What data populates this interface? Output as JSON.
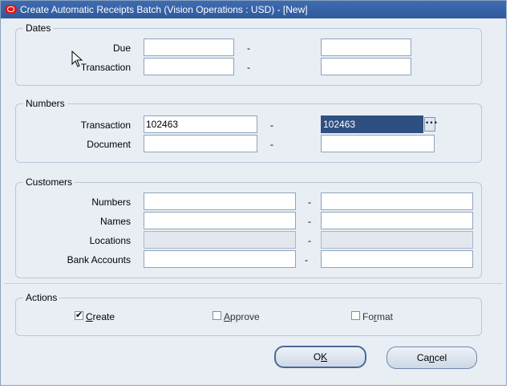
{
  "window": {
    "title": "Create Automatic Receipts Batch (Vision Operations : USD) - [New]"
  },
  "dates": {
    "group_label": "Dates",
    "due_label": "Due",
    "transaction_label": "Transaction",
    "due_from": "",
    "due_to": "",
    "transaction_from": "",
    "transaction_to": ""
  },
  "numbers": {
    "group_label": "Numbers",
    "transaction_label": "Transaction",
    "document_label": "Document",
    "transaction_from": "102463",
    "transaction_to": "102463",
    "document_from": "",
    "document_to": ""
  },
  "customers": {
    "group_label": "Customers",
    "numbers_label": "Numbers",
    "names_label": "Names",
    "locations_label": "Locations",
    "bank_accounts_label": "Bank Accounts",
    "numbers_from": "",
    "numbers_to": "",
    "names_from": "",
    "names_to": "",
    "locations_from": "",
    "locations_to": "",
    "bank_from": "",
    "bank_to": ""
  },
  "range_separator": "-",
  "actions": {
    "group_label": "Actions",
    "create": {
      "first": "C",
      "rest": "reate",
      "checked": true
    },
    "approve": {
      "first": "A",
      "rest": "pprove",
      "checked": false
    },
    "format": {
      "first": "Fo",
      "u": "r",
      "rest": "mat",
      "checked": false
    }
  },
  "buttons": {
    "ok": {
      "pre": "O",
      "u": "K",
      "post": ""
    },
    "cancel": {
      "pre": "Ca",
      "u": "n",
      "post": "cel"
    }
  },
  "colors": {
    "titlebar": "#2f5a9d",
    "background": "#e9eef5",
    "focus": "#2e4f7f"
  }
}
